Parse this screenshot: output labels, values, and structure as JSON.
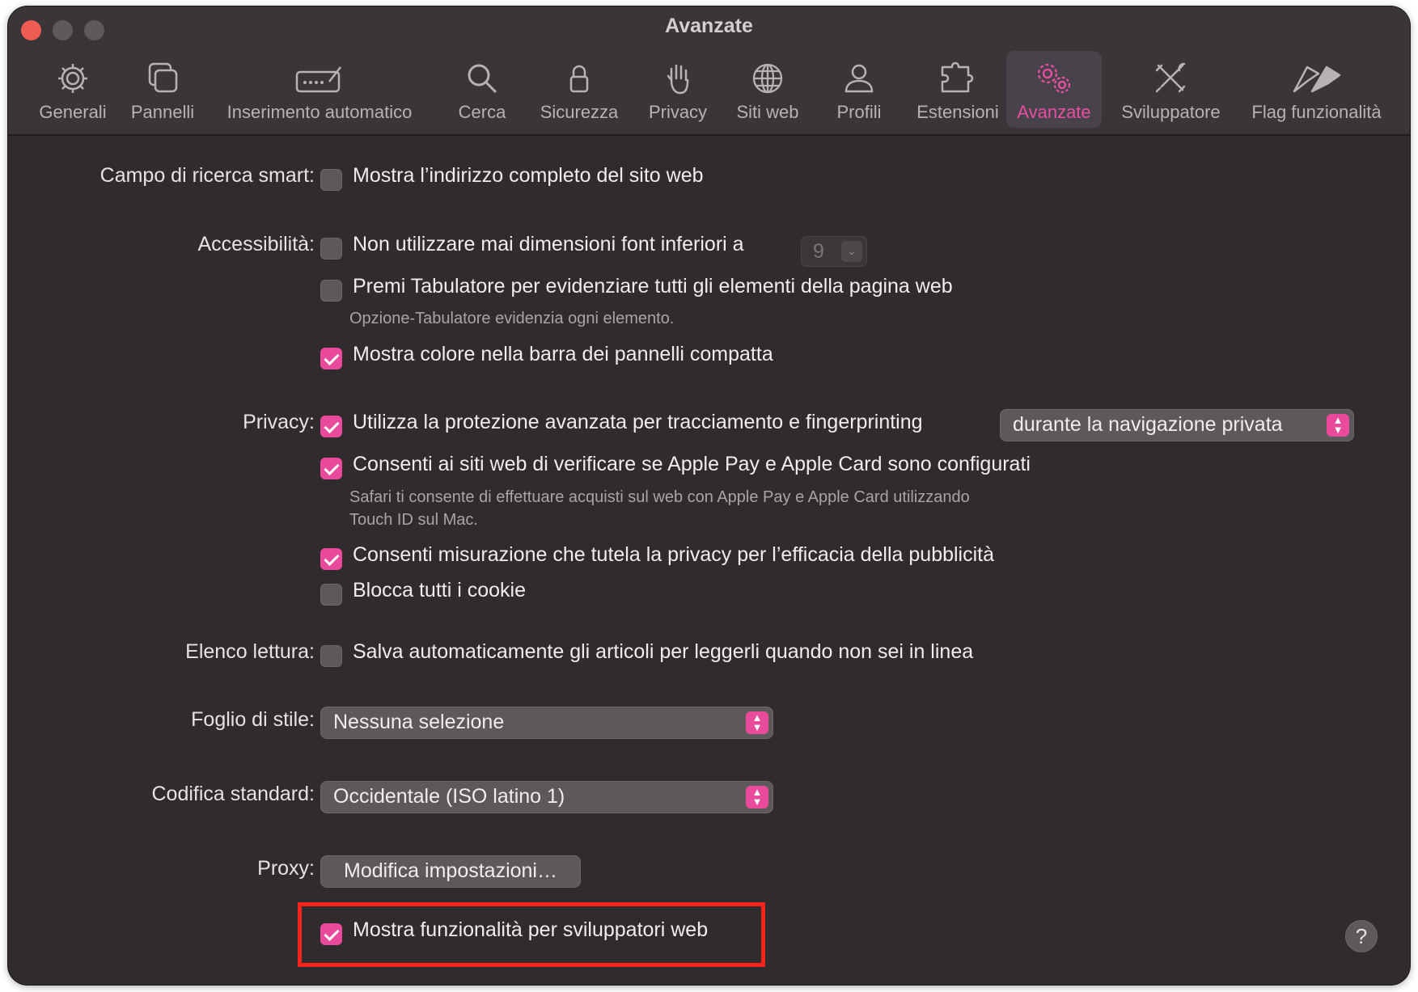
{
  "window": {
    "title": "Avanzate"
  },
  "toolbar": {
    "tabs": [
      {
        "label": "Generali",
        "icon": "gear-icon"
      },
      {
        "label": "Pannelli",
        "icon": "tabs-icon"
      },
      {
        "label": "Inserimento automatico",
        "icon": "autofill-icon"
      },
      {
        "label": "Cerca",
        "icon": "search-icon"
      },
      {
        "label": "Sicurezza",
        "icon": "lock-icon"
      },
      {
        "label": "Privacy",
        "icon": "hand-icon"
      },
      {
        "label": "Siti web",
        "icon": "globe-icon"
      },
      {
        "label": "Profili",
        "icon": "person-icon"
      },
      {
        "label": "Estensioni",
        "icon": "puzzle-icon"
      },
      {
        "label": "Avanzate",
        "icon": "gears-icon",
        "active": true
      },
      {
        "label": "Sviluppatore",
        "icon": "tools-icon"
      },
      {
        "label": "Flag funzionalità",
        "icon": "flags-icon"
      }
    ]
  },
  "accent_color": "#ea4a9c",
  "settings": {
    "smart_search": {
      "label": "Campo di ricerca smart:",
      "full_address": {
        "text": "Mostra l’indirizzo completo del sito web",
        "checked": false
      }
    },
    "accessibility": {
      "label": "Accessibilità:",
      "min_font": {
        "text": "Non utilizzare mai dimensioni font inferiori a",
        "checked": false,
        "value": "9"
      },
      "tab_highlight": {
        "text": "Premi Tabulatore per evidenziare tutti gli elementi della pagina web",
        "checked": false
      },
      "tab_hint": "Opzione-Tabulatore evidenzia ogni elemento.",
      "color_tabbar": {
        "text": "Mostra colore nella barra dei pannelli compatta",
        "checked": true
      }
    },
    "privacy": {
      "label": "Privacy:",
      "tracking": {
        "text": "Utilizza la protezione avanzata per tracciamento e fingerprinting",
        "checked": true,
        "option": "durante la navigazione privata"
      },
      "apple_pay": {
        "text": "Consenti ai siti web di verificare se Apple Pay e Apple Card sono configurati",
        "checked": true
      },
      "apple_pay_hint_1": "Safari ti consente di effettuare acquisti sul web con Apple Pay e Apple Card utilizzando",
      "apple_pay_hint_2": "Touch ID sul Mac.",
      "ad_measure": {
        "text": "Consenti misurazione che tutela la privacy per l’efficacia della pubblicità",
        "checked": true
      },
      "block_cookies": {
        "text": "Blocca tutti i cookie",
        "checked": false
      }
    },
    "reading_list": {
      "label": "Elenco lettura:",
      "offline": {
        "text": "Salva automaticamente gli articoli per leggerli quando non sei in linea",
        "checked": false
      }
    },
    "stylesheet": {
      "label": "Foglio di stile:",
      "value": "Nessuna selezione"
    },
    "encoding": {
      "label": "Codifica standard:",
      "value": "Occidentale (ISO latino 1)"
    },
    "proxy": {
      "label": "Proxy:",
      "button": "Modifica impostazioni…"
    },
    "developer": {
      "text": "Mostra funzionalità per sviluppatori web",
      "checked": true
    }
  },
  "help": {
    "label": "?"
  }
}
